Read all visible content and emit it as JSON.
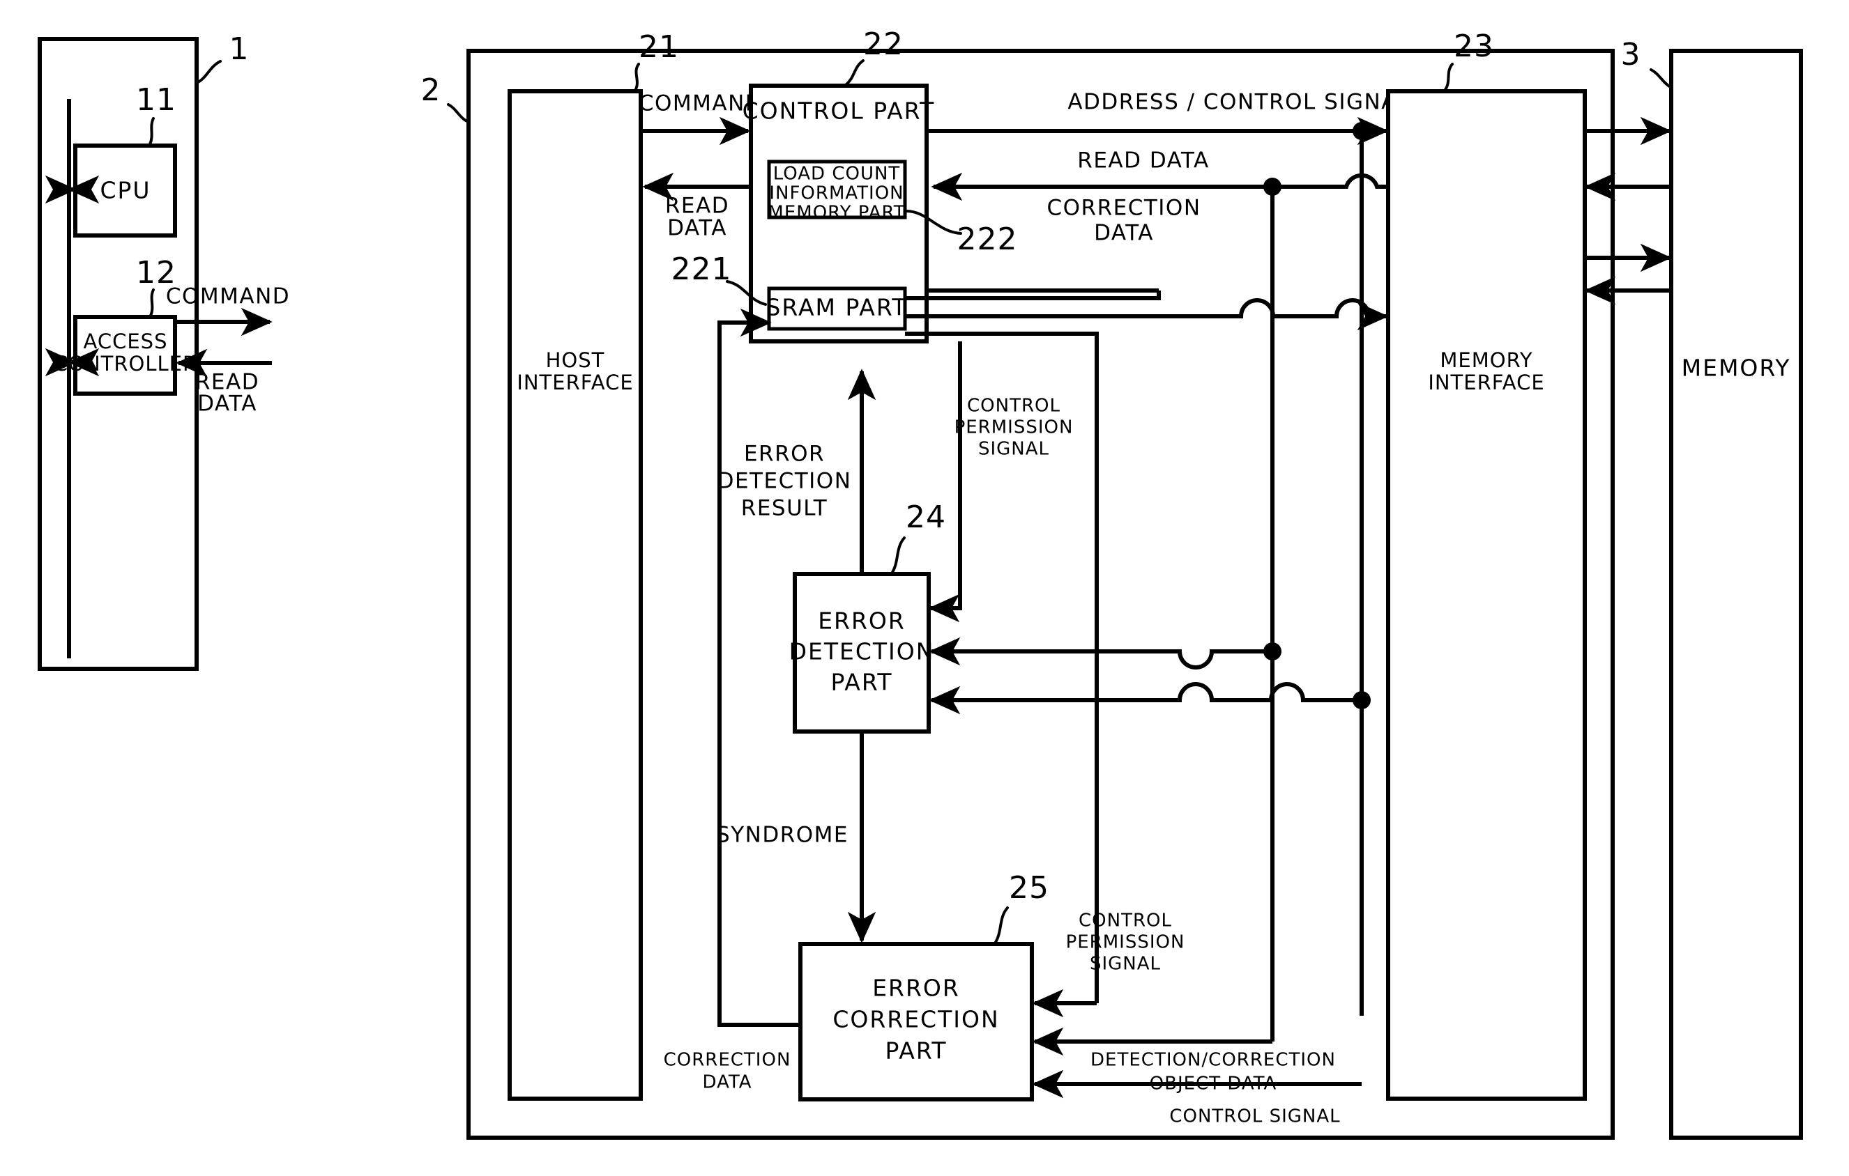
{
  "figure": {
    "type": "patent-block-diagram",
    "background": "#ffffff",
    "ink": "#000000"
  },
  "blocks": {
    "host": {
      "ref": "1",
      "label": ""
    },
    "cpu": {
      "ref": "11",
      "label": "CPU"
    },
    "access_controller": {
      "ref": "12",
      "label_line1": "ACCESS",
      "label_line2": "CONTROLLER"
    },
    "controller": {
      "ref": "2",
      "label": ""
    },
    "host_interface": {
      "ref": "21",
      "label_line1": "HOST",
      "label_line2": "INTERFACE"
    },
    "control_part": {
      "ref": "22",
      "label": "CONTROL PART"
    },
    "load_count_memory": {
      "ref": "222",
      "label_line1": "LOAD COUNT",
      "label_line2": "INFORMATION",
      "label_line3": "MEMORY PART"
    },
    "sram_part": {
      "ref": "221",
      "label": "SRAM PART"
    },
    "memory_interface": {
      "ref": "23",
      "label_line1": "MEMORY",
      "label_line2": "INTERFACE"
    },
    "error_detection_part": {
      "ref": "24",
      "label_line1": "ERROR",
      "label_line2": "DETECTION",
      "label_line3": "PART"
    },
    "error_correction_part": {
      "ref": "25",
      "label_line1": "ERROR",
      "label_line2": "CORRECTION",
      "label_line3": "PART"
    },
    "memory": {
      "ref": "3",
      "label": "MEMORY"
    }
  },
  "signals": {
    "command_top": "COMMAND",
    "command_host": "COMMAND",
    "read_data_host": "READ",
    "read_data_host2": "DATA",
    "read_data_left": "READ",
    "read_data_left2": "DATA",
    "address_control_signal": "ADDRESS / CONTROL SIGNAL",
    "read_data_right": "READ DATA",
    "correction_data_right": "CORRECTION",
    "correction_data_right2": "DATA",
    "control_permission_signal_1": "CONTROL",
    "control_permission_signal_1b": "PERMISSION",
    "control_permission_signal_1c": "SIGNAL",
    "error_detection_result": "ERROR",
    "error_detection_result2": "DETECTION",
    "error_detection_result3": "RESULT",
    "syndrome": "SYNDROME",
    "control_permission_signal_2": "CONTROL",
    "control_permission_signal_2b": "PERMISSION",
    "control_permission_signal_2c": "SIGNAL",
    "correction_data_bottom": "CORRECTION",
    "correction_data_bottom2": "DATA",
    "detection_correction_object": "DETECTION/CORRECTION",
    "detection_correction_object2": "OBJECT DATA",
    "control_signal_bottom": "CONTROL SIGNAL"
  }
}
